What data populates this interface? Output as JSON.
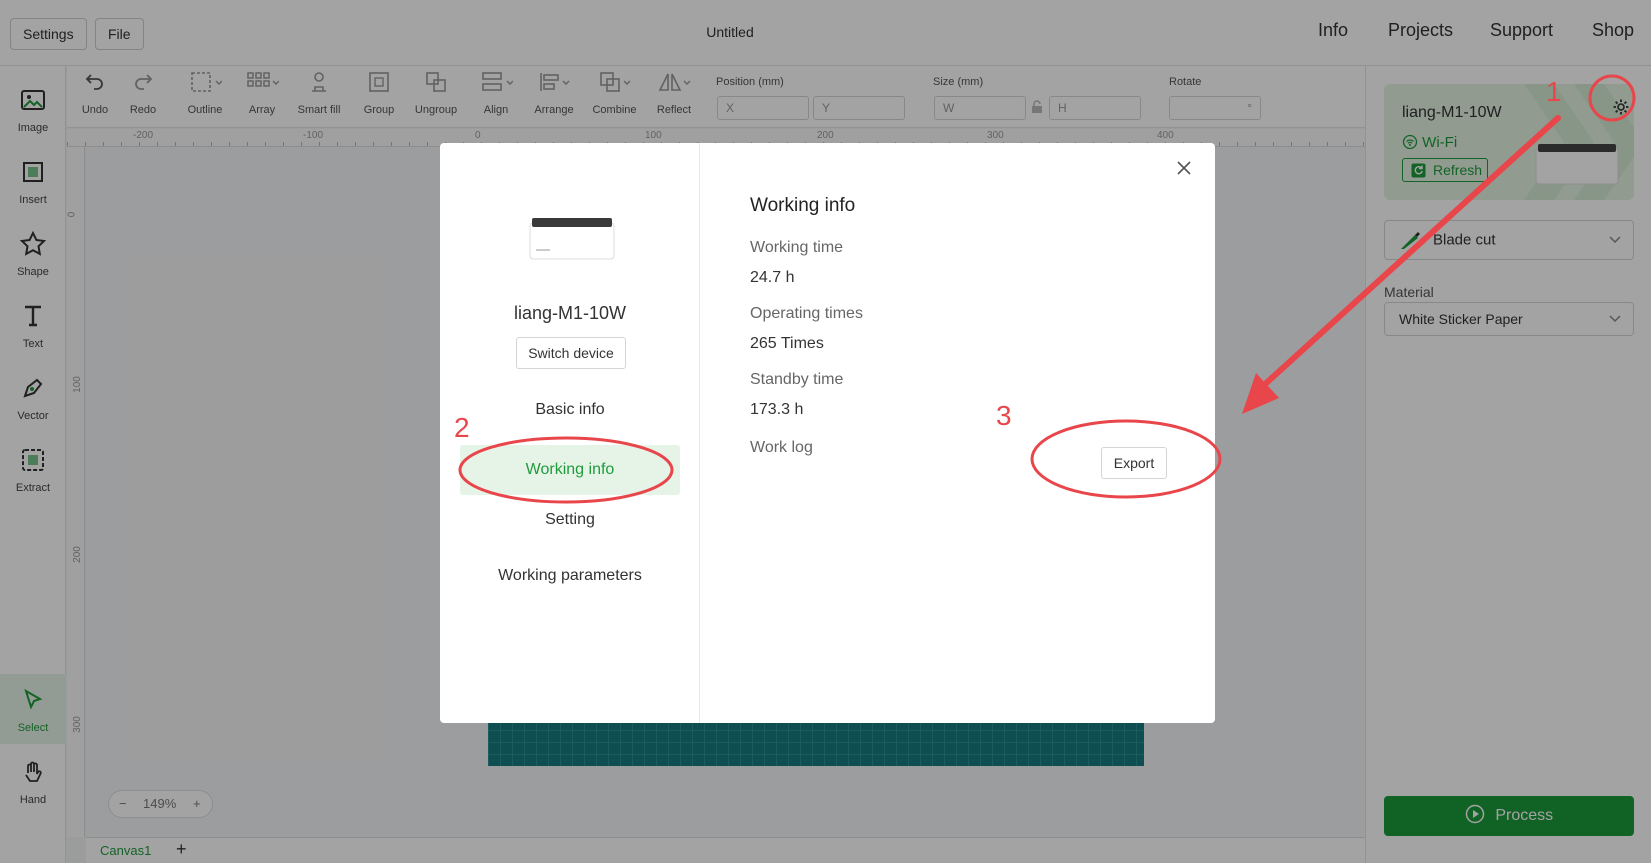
{
  "topbar": {
    "settings_label": "Settings",
    "file_label": "File",
    "title": "Untitled",
    "nav": [
      "Info",
      "Projects",
      "Support",
      "Shop"
    ]
  },
  "left_tools": [
    {
      "label": "Image",
      "icon": "image-icon"
    },
    {
      "label": "Insert",
      "icon": "insert-icon"
    },
    {
      "label": "Shape",
      "icon": "shape-icon"
    },
    {
      "label": "Text",
      "icon": "text-icon"
    },
    {
      "label": "Vector",
      "icon": "vector-icon"
    },
    {
      "label": "Extract",
      "icon": "extract-icon"
    }
  ],
  "bottom_tools": [
    {
      "label": "Select",
      "icon": "select-icon",
      "active": true
    },
    {
      "label": "Hand",
      "icon": "hand-icon",
      "active": false
    }
  ],
  "toolbar": {
    "undo": "Undo",
    "redo": "Redo",
    "outline": "Outline",
    "array": "Array",
    "smart_fill": "Smart fill",
    "group": "Group",
    "ungroup": "Ungroup",
    "align": "Align",
    "arrange": "Arrange",
    "combine": "Combine",
    "reflect": "Reflect",
    "position_label": "Position (mm)",
    "x_placeholder": "X",
    "y_placeholder": "Y",
    "size_label": "Size (mm)",
    "w_placeholder": "W",
    "h_placeholder": "H",
    "rotate_label": "Rotate",
    "rotate_unit": "°"
  },
  "ruler": {
    "h_ticks": [
      "-200",
      "-100",
      "0",
      "100",
      "200",
      "300",
      "400"
    ],
    "v_ticks": [
      "0",
      "100",
      "200",
      "300"
    ]
  },
  "canvas": {
    "zoom_minus": "−",
    "zoom_level": "149%",
    "zoom_plus": "+",
    "tab_name": "Canvas1",
    "add_tab": "+"
  },
  "right_panel": {
    "device_name": "liang-M1-10W",
    "connection": "Wi-Fi",
    "refresh_label": "Refresh",
    "mode": "Blade cut",
    "material_label": "Material",
    "material_value": "White Sticker Paper",
    "process_label": "Process"
  },
  "dialog": {
    "device_name": "liang-M1-10W",
    "switch_label": "Switch device",
    "menu": [
      "Basic info",
      "Working info",
      "Setting",
      "Working parameters"
    ],
    "active_menu": "Working info",
    "title": "Working info",
    "working_time_label": "Working time",
    "working_time_value": "24.7 h",
    "operating_times_label": "Operating times",
    "operating_times_value": "265 Times",
    "standby_time_label": "Standby time",
    "standby_time_value": "173.3 h",
    "work_log_label": "Work log",
    "export_label": "Export"
  },
  "annotations": {
    "step1": "1",
    "step2": "2",
    "step3": "3",
    "color": "#e8464a"
  },
  "colors": {
    "accent": "#1f9b3c",
    "process_bg": "#1c9a3a",
    "mat": "#17797d"
  }
}
